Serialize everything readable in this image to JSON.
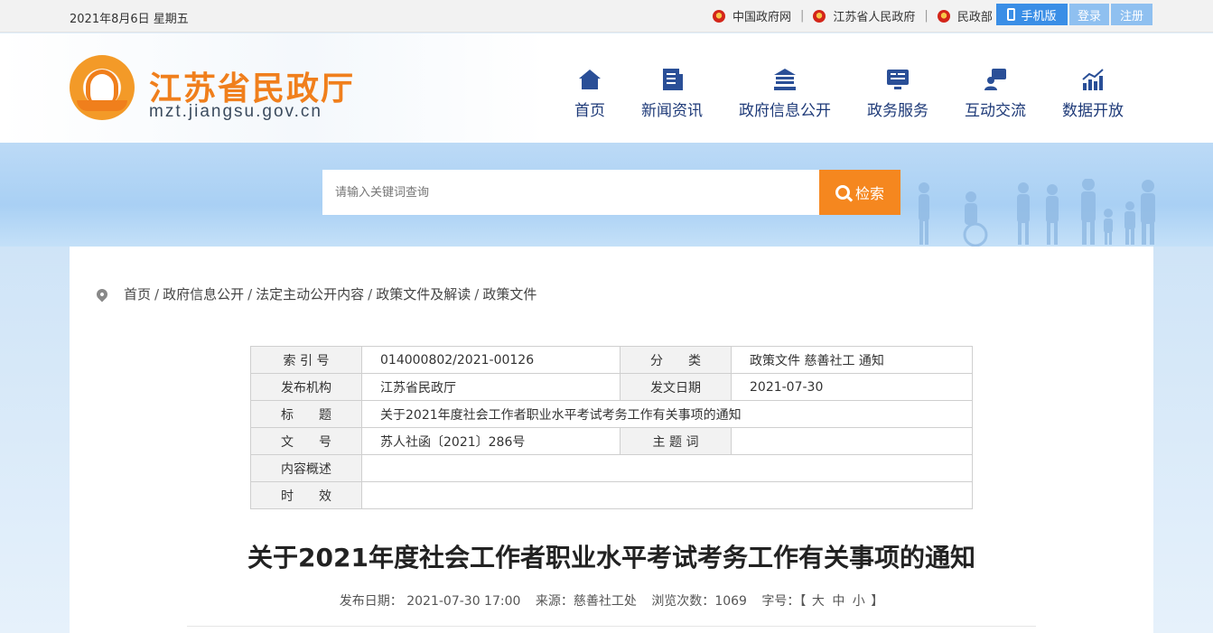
{
  "topbar": {
    "date": "2021年8月6日 星期五",
    "links": [
      "中国政府网",
      "江苏省人民政府",
      "民政部"
    ],
    "mobile_label": "手机版",
    "login_label": "登录",
    "register_label": "注册"
  },
  "header": {
    "site_title": "江苏省民政厅",
    "site_url": "mzt.jiangsu.gov.cn",
    "nav": [
      {
        "label": "首页",
        "icon": "home-icon"
      },
      {
        "label": "新闻资讯",
        "icon": "news-icon"
      },
      {
        "label": "政府信息公开",
        "icon": "building-icon"
      },
      {
        "label": "政务服务",
        "icon": "monitor-icon"
      },
      {
        "label": "互动交流",
        "icon": "chat-icon"
      },
      {
        "label": "数据开放",
        "icon": "chart-icon"
      }
    ]
  },
  "search": {
    "placeholder": "请输入关键词查询",
    "button_label": "检索"
  },
  "breadcrumb": [
    "首页",
    "政府信息公开",
    "法定主动公开内容",
    "政策文件及解读",
    "政策文件"
  ],
  "meta_table": {
    "index_label": "索 引 号",
    "index_value": "014000802/2021-00126",
    "category_label": "分　　类",
    "category_value": "政策文件 慈善社工 通知",
    "publisher_label": "发布机构",
    "publisher_value": "江苏省民政厅",
    "issue_date_label": "发文日期",
    "issue_date_value": "2021-07-30",
    "title_label": "标　　题",
    "title_value": "关于2021年度社会工作者职业水平考试考务工作有关事项的通知",
    "doc_no_label": "文　　号",
    "doc_no_value": "苏人社函〔2021〕286号",
    "keywords_label": "主 题 词",
    "keywords_value": "",
    "summary_label": "内容概述",
    "summary_value": "",
    "validity_label": "时　　效",
    "validity_value": ""
  },
  "article": {
    "title": "关于2021年度社会工作者职业水平考试考务工作有关事项的通知",
    "publish_date_label": "发布日期：",
    "publish_date": "2021-07-30 17:00",
    "source_label": "来源：",
    "source": "慈善社工处",
    "views_label": "浏览次数：",
    "views": "1069",
    "font_size_label": "字号：",
    "font_sizes": [
      "大",
      "中",
      "小"
    ]
  },
  "colors": {
    "accent_orange": "#f5871f",
    "nav_blue": "#1e3a78",
    "mobile_blue": "#3a8ee6"
  }
}
